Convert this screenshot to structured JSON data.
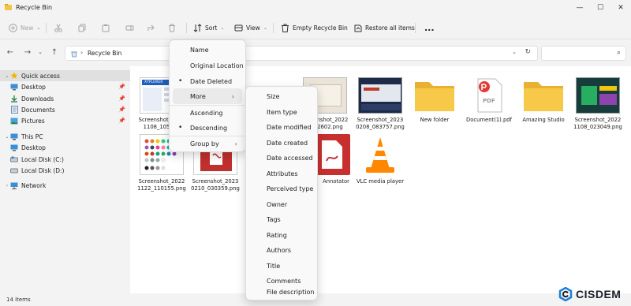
{
  "window": {
    "title": "Recycle Bin"
  },
  "toolbar": {
    "new_label": "New",
    "sort_label": "Sort",
    "view_label": "View",
    "empty_label": "Empty Recycle Bin",
    "restore_label": "Restore all items",
    "more_label": "..."
  },
  "address": {
    "path": "Recycle Bin"
  },
  "search": {
    "placeholder": ""
  },
  "sidebar": {
    "quick_access": "Quick access",
    "items": [
      {
        "label": "Desktop"
      },
      {
        "label": "Downloads"
      },
      {
        "label": "Documents"
      },
      {
        "label": "Pictures"
      }
    ],
    "this_pc": "This PC",
    "pc_items": [
      {
        "label": "Desktop"
      },
      {
        "label": "Local Disk (C:)"
      },
      {
        "label": "Local Disk (D:)"
      }
    ],
    "network": "Network"
  },
  "files": [
    {
      "line1": "Screenshot_2022",
      "line2": "1108_105017"
    },
    {
      "line1": "Screenshot_2022",
      "line2": "1032602.png"
    },
    {
      "line1": "Screenshot_2023",
      "line2": "0208_083757.png"
    },
    {
      "line1": "New folder",
      "line2": ""
    },
    {
      "line1": "Document(1).pdf",
      "line2": ""
    },
    {
      "line1": "Amazing Studio",
      "line2": ""
    },
    {
      "line1": "Screenshot_2022",
      "line2": "1108_023049.png"
    },
    {
      "line1": "Screenshot_2022",
      "line2": "1122_110155.png"
    },
    {
      "line1": "Screenshot_2023",
      "line2": "0210_030359.png"
    },
    {
      "line1": "Annotator",
      "line2": ""
    },
    {
      "line1": "VLC media player",
      "line2": ""
    }
  ],
  "pdf_badge": "PDF",
  "thumb_text": {
    "xyplorer": "XYPLORER"
  },
  "status": {
    "count": "14 items"
  },
  "sort_menu": {
    "items": [
      {
        "label": "Name",
        "bullet": ""
      },
      {
        "label": "Original Location",
        "bullet": ""
      },
      {
        "label": "Date Deleted",
        "bullet": "•"
      },
      {
        "label": "More",
        "bullet": ""
      },
      {
        "label": "Ascending",
        "bullet": ""
      },
      {
        "label": "Descending",
        "bullet": "•"
      },
      {
        "label": "Group by",
        "bullet": ""
      }
    ]
  },
  "more_menu": {
    "items": [
      "Size",
      "Item type",
      "Date modified",
      "Date created",
      "Date accessed",
      "Attributes",
      "Perceived type",
      "Owner",
      "Tags",
      "Rating",
      "Authors",
      "Title",
      "Comments",
      "File description"
    ]
  },
  "watermark": {
    "text": "CISDEM"
  },
  "colors": {
    "folder": "#f4c542",
    "accent": "#0067c0",
    "selected": "#e0e0e0"
  }
}
